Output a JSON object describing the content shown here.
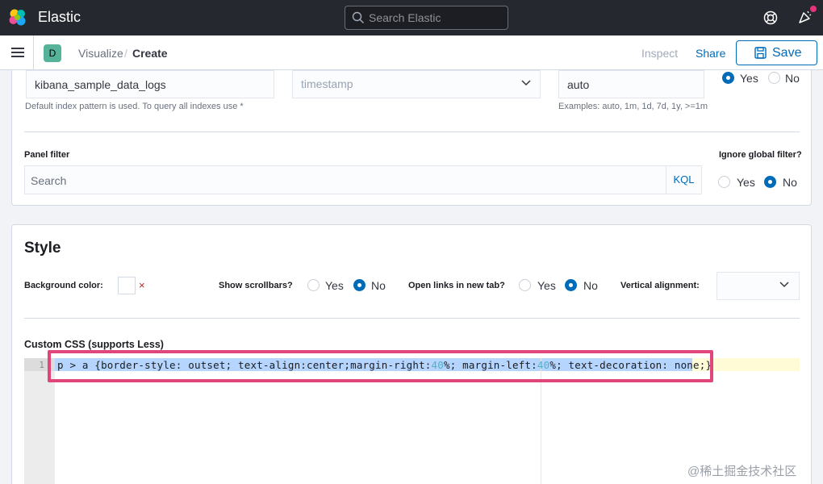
{
  "header": {
    "brand": "Elastic",
    "search_placeholder": "Search Elastic"
  },
  "nav": {
    "space_initial": "D",
    "breadcrumbs": [
      "Visualize",
      "Create"
    ],
    "breadcrumb_separator": "/",
    "inspect_label": "Inspect",
    "share_label": "Share",
    "save_label": "Save"
  },
  "data_panel": {
    "index_pattern_value": "kibana_sample_data_logs",
    "index_help": "Default index pattern is used. To query all indexes use *",
    "time_field_placeholder": "timestamp",
    "interval_value": "auto",
    "interval_help": "Examples: auto, 1m, 1d, 7d, 1y, >=1m",
    "drop_last_bucket": {
      "yes": "Yes",
      "no": "No",
      "selected": "Yes"
    },
    "panel_filter_label": "Panel filter",
    "panel_filter_placeholder": "Search",
    "query_language": "KQL",
    "ignore_global_label": "Ignore global filter?",
    "ignore_global": {
      "yes": "Yes",
      "no": "No",
      "selected": "No"
    }
  },
  "style_panel": {
    "title": "Style",
    "background_color_label": "Background color:",
    "clear_icon": "×",
    "show_scrollbars_label": "Show scrollbars?",
    "show_scrollbars": {
      "yes": "Yes",
      "no": "No",
      "selected": "No"
    },
    "open_links_label": "Open links in new tab?",
    "open_links": {
      "yes": "Yes",
      "no": "No",
      "selected": "No"
    },
    "vertical_alignment_label": "Vertical alignment:",
    "custom_css_label": "Custom CSS (supports Less)",
    "editor": {
      "line_number": "1",
      "code_parts": [
        "p > a {border-style: outset; text-align:center;margin-right:",
        "40",
        "%; margin-left:",
        "40",
        "%; text-decoration: none;}"
      ]
    }
  },
  "watermark": "@稀土掘金技术社区",
  "colors": {
    "header_bg": "#25282f",
    "accent": "#006bb8",
    "highlight_box": "#e0457b",
    "space_avatar": "#54b399"
  }
}
